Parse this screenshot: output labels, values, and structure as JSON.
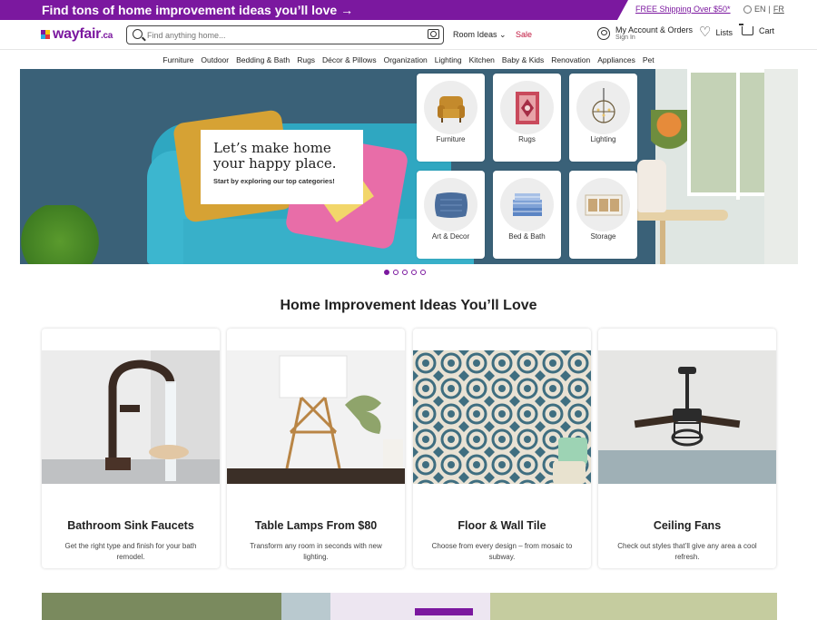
{
  "promo": {
    "headline": "Find tons of home improvement ideas you’ll love",
    "arrow": "→",
    "shipping": "FREE Shipping Over $50*",
    "lang_en": "EN",
    "lang_sep": "|",
    "lang_fr": "FR"
  },
  "header": {
    "logo_text": "wayfair",
    "logo_suffix": ".ca",
    "search_placeholder": "Find anything home...",
    "room_ideas": "Room Ideas",
    "room_ideas_caret": "⌄",
    "sale": "Sale",
    "account_line1": "My Account & Orders",
    "account_line2": "Sign In",
    "lists": "Lists",
    "cart": "Cart",
    "brand_colors": [
      "#7b189f",
      "#f2c80f",
      "#e2363c",
      "#29a9e1"
    ]
  },
  "nav": {
    "items": [
      "Furniture",
      "Outdoor",
      "Bedding & Bath",
      "Rugs",
      "Décor & Pillows",
      "Organization",
      "Lighting",
      "Kitchen",
      "Baby & Kids",
      "Renovation",
      "Appliances",
      "Pet"
    ]
  },
  "hero": {
    "heading": "Let’s make home your happy place.",
    "subheading": "Start by exploring our top categories!",
    "tiles": [
      {
        "label": "Furniture",
        "icon": "armchair-icon"
      },
      {
        "label": "Rugs",
        "icon": "rug-icon"
      },
      {
        "label": "Lighting",
        "icon": "chandelier-icon"
      },
      {
        "label": "Art & Decor",
        "icon": "pillow-icon"
      },
      {
        "label": "Bed & Bath",
        "icon": "sheets-icon"
      },
      {
        "label": "Storage",
        "icon": "storage-bins-icon"
      }
    ],
    "carousel_slides": 5,
    "carousel_active": 1
  },
  "ideas": {
    "title": "Home Improvement Ideas You’ll Love",
    "cards": [
      {
        "title": "Bathroom Sink Faucets",
        "desc": "Get the right type and finish for your bath remodel."
      },
      {
        "title": "Table Lamps From $80",
        "desc": "Transform any room in seconds with new lighting."
      },
      {
        "title": "Floor & Wall Tile",
        "desc": "Choose from every design – from mosaic to subway."
      },
      {
        "title": "Ceiling Fans",
        "desc": "Check out styles that’ll give any area a cool refresh."
      }
    ]
  },
  "colors": {
    "accent": "#7b189f",
    "sale": "#c0143c"
  }
}
